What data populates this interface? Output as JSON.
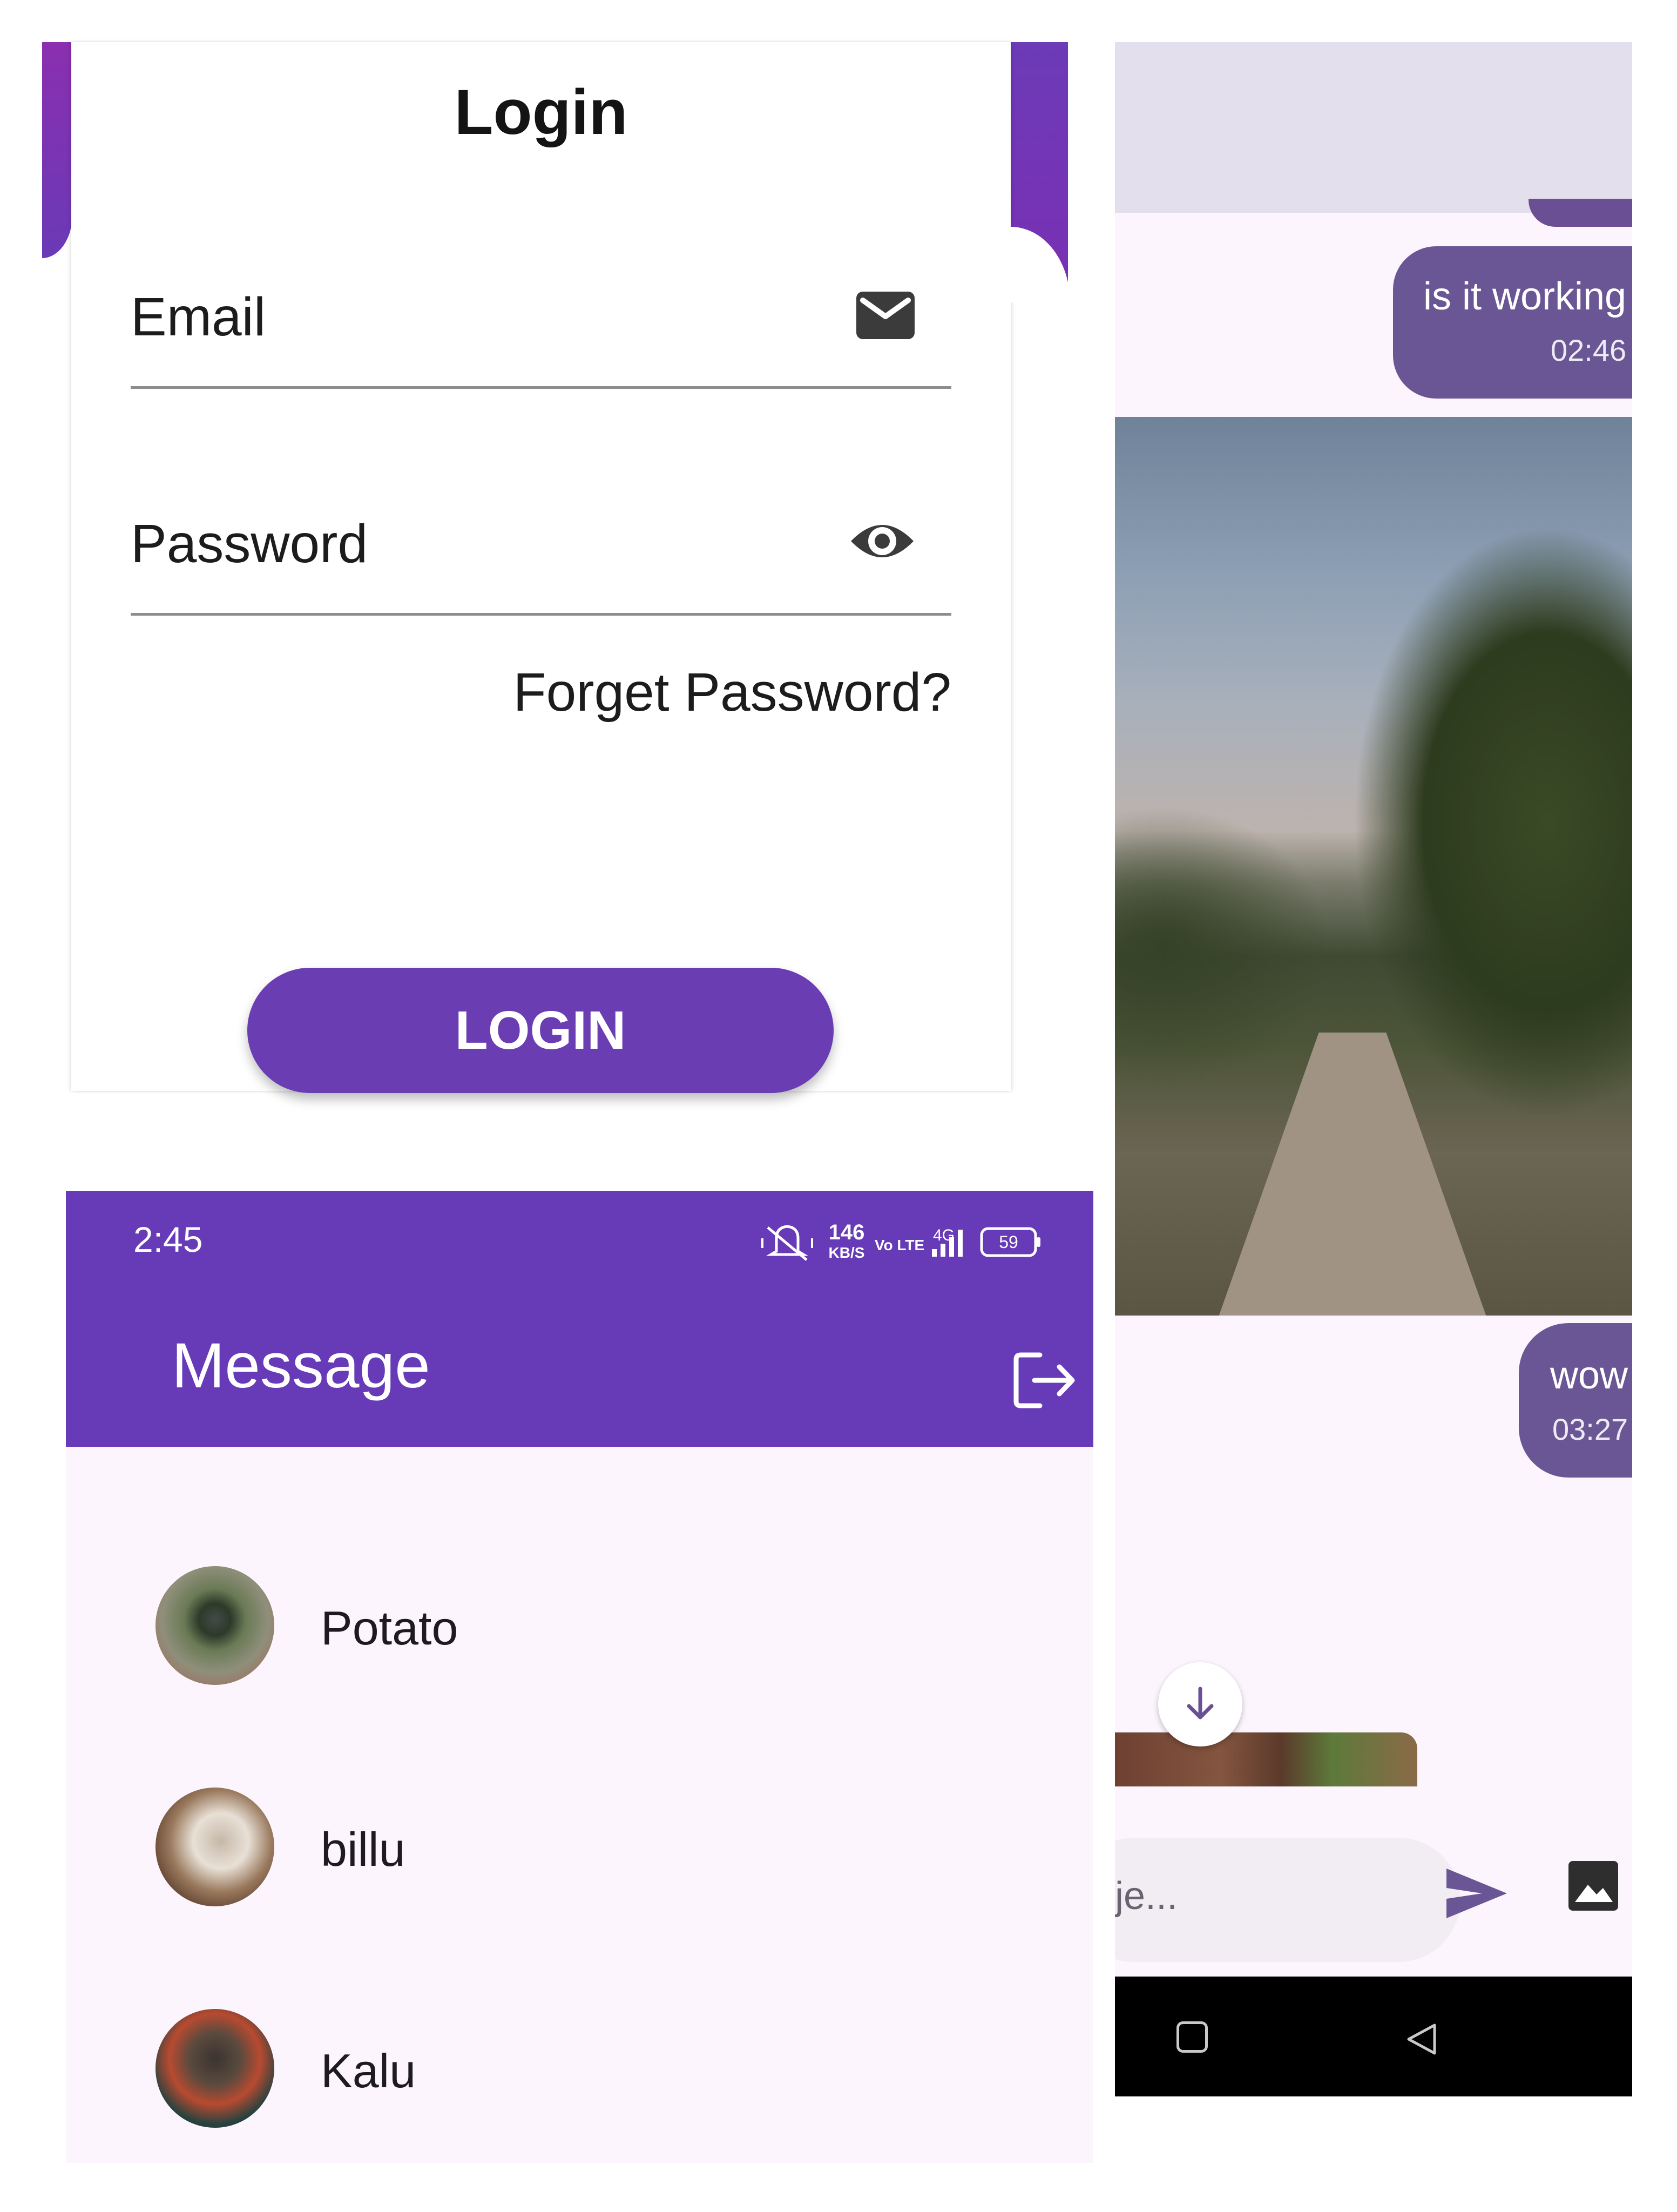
{
  "login": {
    "title": "Login",
    "email_label": "Email",
    "password_label": "Password",
    "forget_password": "Forget Password?",
    "login_button": "LOGIN"
  },
  "chat": {
    "messages": [
      {
        "text": "is it working",
        "time": "02:46"
      },
      {
        "text": "wow",
        "time": "03:27"
      }
    ],
    "input_placeholder": "je..."
  },
  "message_list": {
    "status_time": "2:45",
    "status_speed": "146",
    "status_speed_unit": "KB/S",
    "status_volte": "Vo LTE",
    "status_network": "4G",
    "battery": "59",
    "title": "Message",
    "contacts": [
      {
        "name": "Potato"
      },
      {
        "name": "billu"
      },
      {
        "name": "Kalu"
      }
    ]
  },
  "colors": {
    "primary": "#673ab7",
    "bubble": "#6a5694",
    "background": "#fcf5fd"
  },
  "icons": [
    "mail-icon",
    "eye-icon",
    "arrow-down-icon",
    "send-icon",
    "image-icon",
    "logout-icon",
    "nav-home-square-icon",
    "nav-back-icon"
  ]
}
